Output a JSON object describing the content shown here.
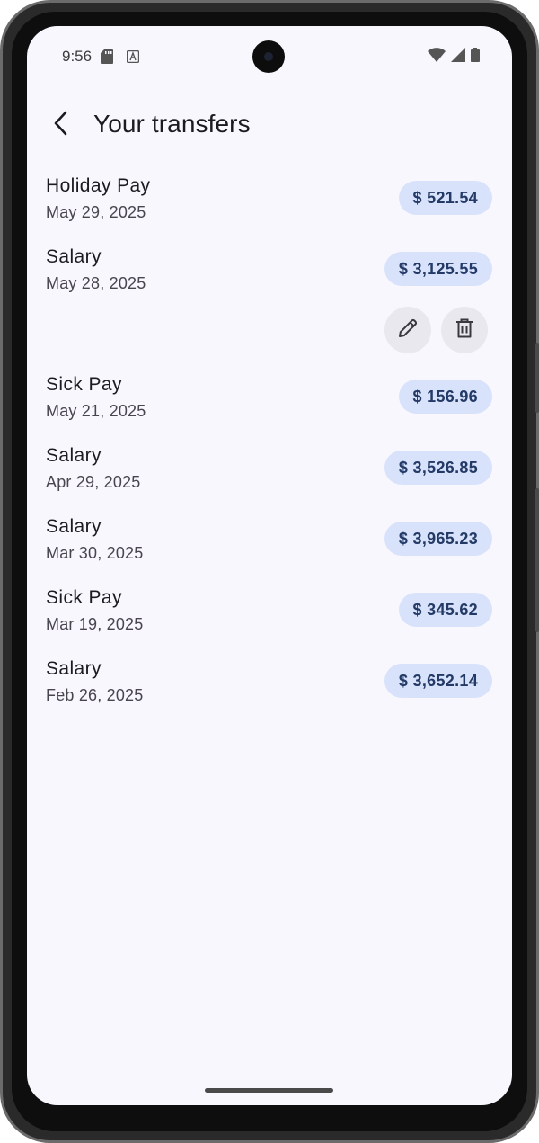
{
  "status_bar": {
    "time": "9:56",
    "icons": [
      "sd-card-icon",
      "keyboard-a-icon",
      "wifi-icon",
      "signal-icon",
      "battery-icon"
    ]
  },
  "app_bar": {
    "title": "Your transfers",
    "back_icon": "chevron-left-icon"
  },
  "transfers": [
    {
      "title": "Holiday Pay",
      "date": "May 29, 2025",
      "amount": "$ 521.54"
    },
    {
      "title": "Salary",
      "date": "May 28, 2025",
      "amount": "$ 3,125.55",
      "expanded": true
    },
    {
      "title": "Sick Pay",
      "date": "May 21, 2025",
      "amount": "$ 156.96"
    },
    {
      "title": "Salary",
      "date": "Apr 29, 2025",
      "amount": "$ 3,526.85"
    },
    {
      "title": "Salary",
      "date": "Mar 30, 2025",
      "amount": "$ 3,965.23"
    },
    {
      "title": "Sick Pay",
      "date": "Mar 19, 2025",
      "amount": "$ 345.62"
    },
    {
      "title": "Salary",
      "date": "Feb 26, 2025",
      "amount": "$ 3,652.14"
    }
  ],
  "row_actions": {
    "edit_icon": "pencil-icon",
    "delete_icon": "trash-icon"
  },
  "colors": {
    "background": "#f8f7fe",
    "chip_background": "#d8e3fb",
    "chip_text": "#243a66",
    "action_button_background": "#e9e8ee"
  }
}
